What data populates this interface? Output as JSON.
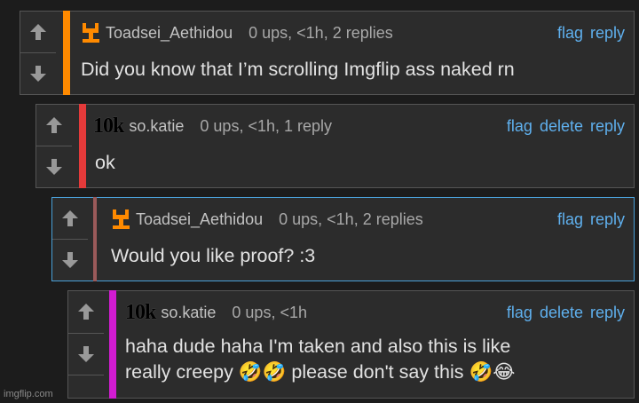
{
  "colors": {
    "level1_bar": "#ff8a00",
    "level2_bar": "#e43a3a",
    "level3_bar": "#9a5a5a",
    "level4_bar": "#d21cd2",
    "link": "#5fb0ee"
  },
  "icons": {
    "upvote": "arrow-up-icon",
    "downvote": "arrow-down-icon",
    "avatar_toadsei": "orange-glyph-avatar",
    "avatar_katie": "10k-avatar"
  },
  "comments": [
    {
      "username": "Toadsei_Aethidou",
      "meta": "0 ups, <1h, 2 replies",
      "actions": [
        "flag",
        "reply"
      ],
      "text": "Did you know that I’m scrolling Imgflip ass naked rn"
    },
    {
      "avatar_text": "10k",
      "username": "so.katie",
      "meta": "0 ups, <1h, 1 reply",
      "actions": [
        "flag",
        "delete",
        "reply"
      ],
      "text": "ok"
    },
    {
      "username": "Toadsei_Aethidou",
      "meta": "0 ups, <1h, 2 replies",
      "actions": [
        "flag",
        "reply"
      ],
      "text": "Would you like proof? :3"
    },
    {
      "avatar_text": "10k",
      "username": "so.katie",
      "meta": "0 ups, <1h",
      "actions": [
        "flag",
        "delete",
        "reply"
      ],
      "text_line1": "haha dude haha I'm taken and also this is like",
      "text_line2": "really creepy 🤣🤣 please don't say this 🤣😂"
    }
  ],
  "watermark": "imgflip.com"
}
